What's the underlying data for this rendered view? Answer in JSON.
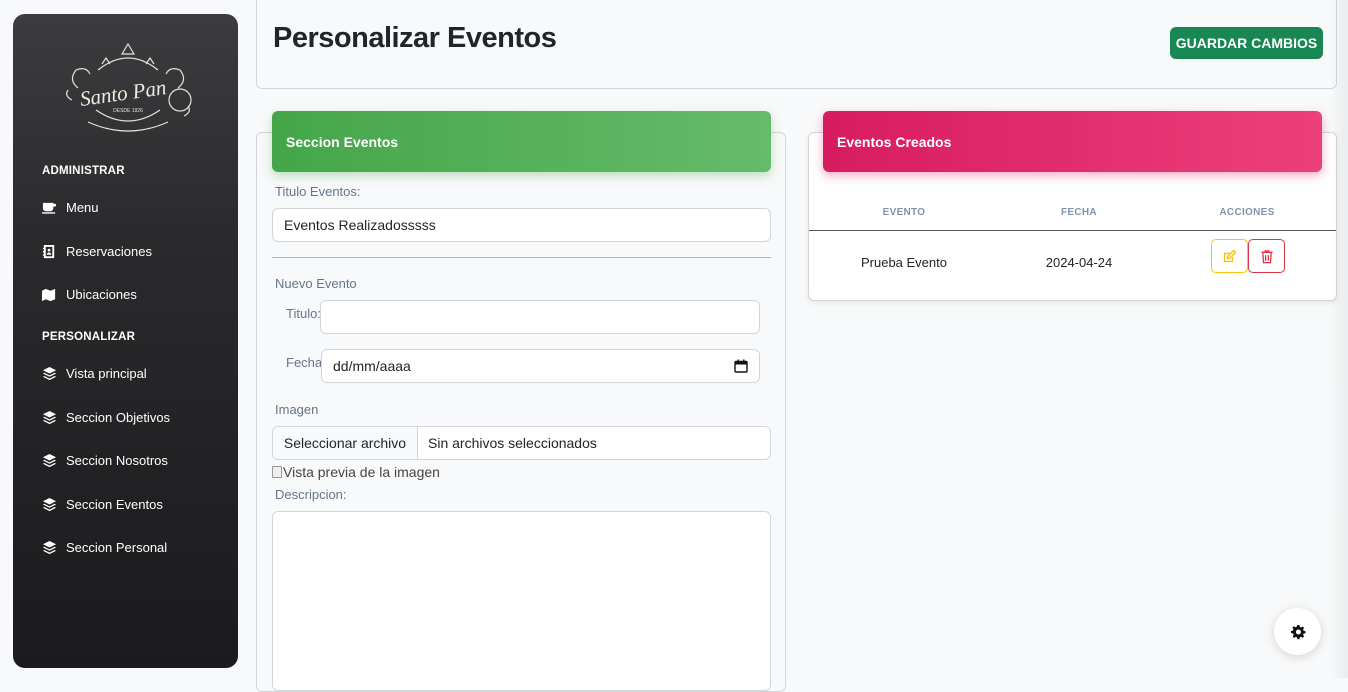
{
  "sidebar": {
    "logo_text": "Santo Pan",
    "logo_sub": "Desde 1926",
    "sections": [
      {
        "title": "ADMINISTRAR"
      },
      {
        "title": "PERSONALIZAR"
      }
    ],
    "items": [
      {
        "label": "Menu",
        "icon": "coffee-icon"
      },
      {
        "label": "Reservaciones",
        "icon": "address-book-icon"
      },
      {
        "label": "Ubicaciones",
        "icon": "map-icon"
      },
      {
        "label": "Vista principal",
        "icon": "layers-icon"
      },
      {
        "label": "Seccion Objetivos",
        "icon": "layers-icon"
      },
      {
        "label": "Seccion Nosotros",
        "icon": "layers-icon"
      },
      {
        "label": "Seccion Eventos",
        "icon": "layers-icon"
      },
      {
        "label": "Seccion Personal",
        "icon": "layers-icon"
      }
    ]
  },
  "header": {
    "title": "Personalizar Eventos",
    "save_label": "GUARDAR CAMBIOS"
  },
  "left_card": {
    "title": "Seccion Eventos",
    "titulo_eventos_label": "Titulo Eventos:",
    "titulo_eventos_value": "Eventos Realizadosssss",
    "nuevo_evento_label": "Nuevo Evento",
    "titulo_label": "Titulo:",
    "titulo_value": "",
    "fecha_label": "Fecha:",
    "fecha_placeholder": "dd/mm/aaaa",
    "imagen_label": "Imagen",
    "file_button": "Seleccionar archivo",
    "file_status": "Sin archivos seleccionados",
    "preview_alt": "Vista previa de la imagen",
    "descripcion_label": "Descripcion:"
  },
  "right_card": {
    "title": "Eventos Creados",
    "columns": [
      "EVENTO",
      "FECHA",
      "ACCIONES"
    ],
    "rows": [
      {
        "evento": "Prueba Evento",
        "fecha": "2024-04-24"
      }
    ]
  },
  "colors": {
    "green_header": "#4caf50",
    "pink_header": "#e91e63",
    "save_button": "#198754",
    "edit_outline": "#ffc107",
    "delete_outline": "#dc3545"
  }
}
